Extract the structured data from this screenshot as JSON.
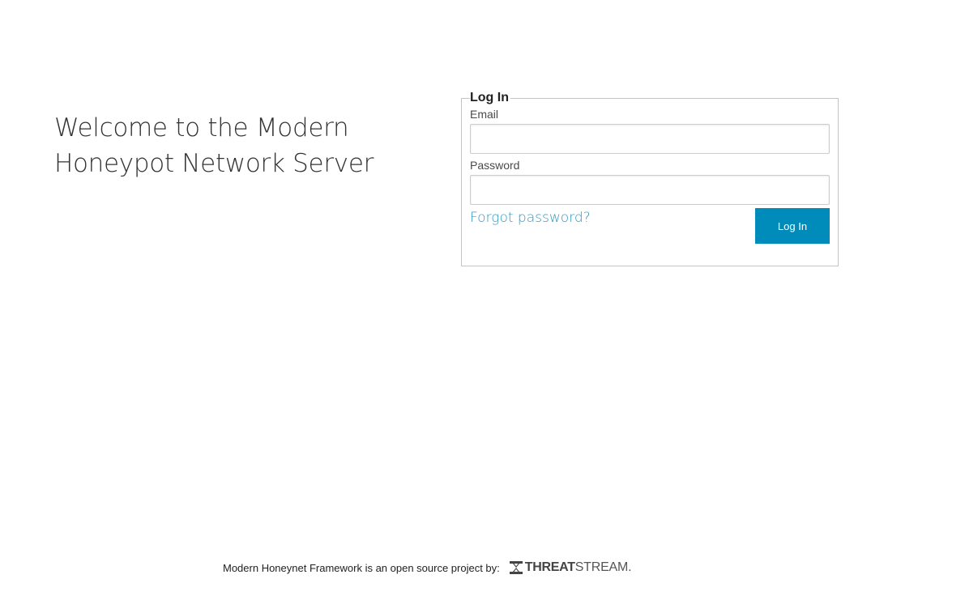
{
  "welcome": {
    "line1": "Welcome to the Modern",
    "line2": "Honeypot Network Server"
  },
  "login_form": {
    "legend": "Log In",
    "email_label": "Email",
    "email_value": "",
    "password_label": "Password",
    "password_value": "",
    "forgot_label": "Forgot password?",
    "submit_label": "Log In"
  },
  "footer": {
    "text": "Modern Honeynet Framework is an open source project by:",
    "brand_part1": "THREAT",
    "brand_part2": "STREAM.",
    "brand_icon": "threatstream-logo-icon"
  },
  "colors": {
    "accent": "#008cba",
    "link": "#2b9bc4",
    "border": "#c4c4c4"
  }
}
